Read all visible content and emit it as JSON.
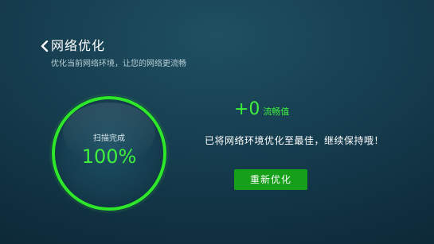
{
  "header": {
    "back_icon": "chevron-left-icon",
    "title": "网络优化",
    "subtitle": "优化当前网络环境，让您的网络更流畅"
  },
  "gauge": {
    "label": "扫描完成",
    "value": "100%",
    "progress": 1.0,
    "ring_color": "#2ee62a"
  },
  "result": {
    "score": "+0",
    "score_unit": "流畅值",
    "message": "已将网络环境优化至最佳，继续保持哦！"
  },
  "actions": {
    "reoptimize_label": "重新优化"
  },
  "colors": {
    "accent_green": "#3ef03b",
    "button_green": "#16a01a",
    "background": "#163e50"
  }
}
